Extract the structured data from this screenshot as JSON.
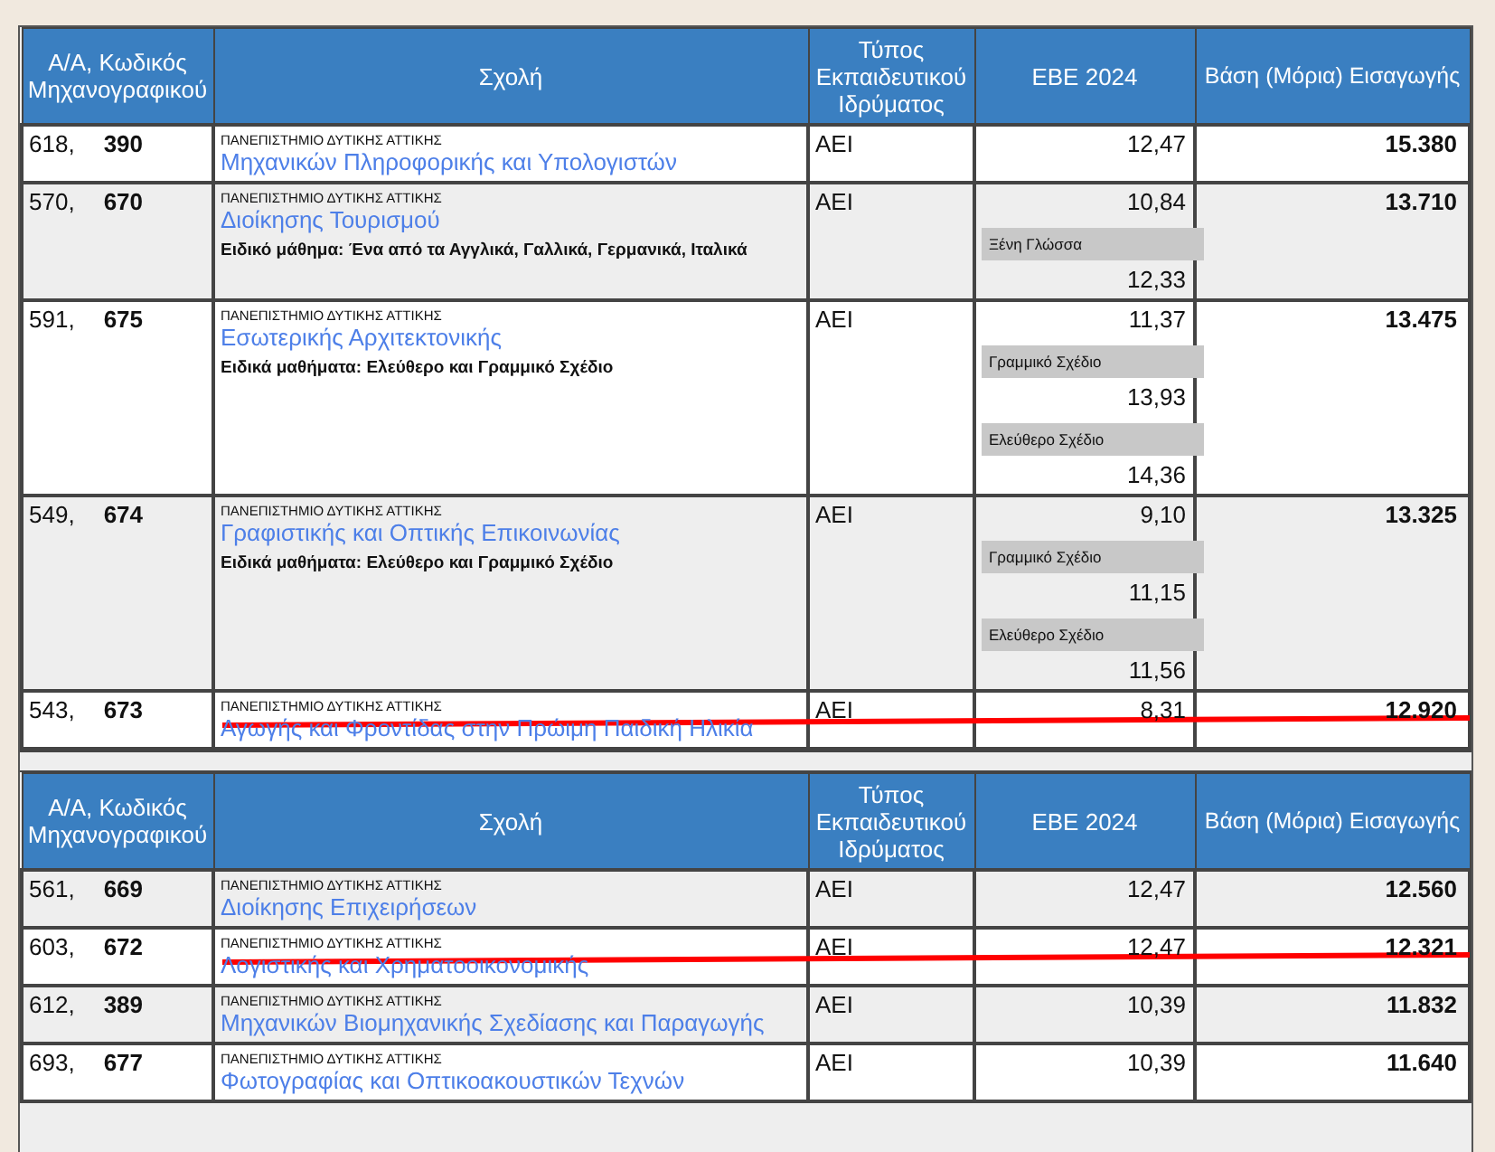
{
  "groups": [
    {
      "columns": [
        "Α/Α, Κωδικός Μηχανογραφικού",
        "Σχολή",
        "Τύπος Εκπαιδευτικού Ιδρύματος",
        "ΕΒΕ 2024",
        "Βάση (Μόρια) Εισαγωγής"
      ],
      "rows": [
        {
          "aa": "618,",
          "code": "390",
          "university": "ΠΑΝΕΠΙΣΤΗΜΙΟ ΔΥΤΙΚΗΣ ΑΤΤΙΚΗΣ",
          "school": "Μηχανικών Πληροφορικής και Υπολογιστών",
          "type": "ΑΕΙ",
          "ebe": "12,47",
          "base": "15.380",
          "struck": false
        },
        {
          "aa": "570,",
          "code": "670",
          "university": "ΠΑΝΕΠΙΣΤΗΜΙΟ ΔΥΤΙΚΗΣ ΑΤΤΙΚΗΣ",
          "school": "Διοίκησης Τουρισμού",
          "note": "Ειδικό μάθημα: Ένα από τα Αγγλικά, Γαλλικά, Γερμανικά, Ιταλικά",
          "type": "ΑΕΙ",
          "ebe": "10,84",
          "extra": [
            {
              "label": "Ξένη Γλώσσα",
              "value": "12,33"
            }
          ],
          "base": "13.710",
          "struck": false
        },
        {
          "aa": "591,",
          "code": "675",
          "university": "ΠΑΝΕΠΙΣΤΗΜΙΟ ΔΥΤΙΚΗΣ ΑΤΤΙΚΗΣ",
          "school": "Εσωτερικής Αρχιτεκτονικής",
          "note": "Ειδικά μαθήματα: Ελεύθερο και Γραμμικό Σχέδιο",
          "type": "ΑΕΙ",
          "ebe": "11,37",
          "extra": [
            {
              "label": "Γραμμικό Σχέδιο",
              "value": "13,93"
            },
            {
              "label": "Ελεύθερο Σχέδιο",
              "value": "14,36"
            }
          ],
          "base": "13.475",
          "struck": false
        },
        {
          "aa": "549,",
          "code": "674",
          "university": "ΠΑΝΕΠΙΣΤΗΜΙΟ ΔΥΤΙΚΗΣ ΑΤΤΙΚΗΣ",
          "school": "Γραφιστικής και Οπτικής Επικοινωνίας",
          "note": "Ειδικά μαθήματα: Ελεύθερο και Γραμμικό Σχέδιο",
          "type": "ΑΕΙ",
          "ebe": "9,10",
          "extra": [
            {
              "label": "Γραμμικό Σχέδιο",
              "value": "11,15"
            },
            {
              "label": "Ελεύθερο Σχέδιο",
              "value": "11,56"
            }
          ],
          "base": "13.325",
          "struck": false
        },
        {
          "aa": "543,",
          "code": "673",
          "university": "ΠΑΝΕΠΙΣΤΗΜΙΟ ΔΥΤΙΚΗΣ ΑΤΤΙΚΗΣ",
          "school": "Αγωγής και Φροντίδας στην Πρώιμη Παιδική Ηλικία",
          "type": "ΑΕΙ",
          "ebe": "8,31",
          "base": "12.920",
          "struck": true
        }
      ]
    },
    {
      "columns": [
        "Α/Α, Κωδικός Μηχανογραφικού",
        "Σχολή",
        "Τύπος Εκπαιδευτικού Ιδρύματος",
        "ΕΒΕ 2024",
        "Βάση (Μόρια) Εισαγωγής"
      ],
      "rows": [
        {
          "aa": "561,",
          "code": "669",
          "university": "ΠΑΝΕΠΙΣΤΗΜΙΟ ΔΥΤΙΚΗΣ ΑΤΤΙΚΗΣ",
          "school": "Διοίκησης Επιχειρήσεων",
          "type": "ΑΕΙ",
          "ebe": "12,47",
          "base": "12.560",
          "struck": false
        },
        {
          "aa": "603,",
          "code": "672",
          "university": "ΠΑΝΕΠΙΣΤΗΜΙΟ ΔΥΤΙΚΗΣ ΑΤΤΙΚΗΣ",
          "school": "Λογιστικής και Χρηματοοικονομικής",
          "type": "ΑΕΙ",
          "ebe": "12,47",
          "base": "12.321",
          "struck": true
        },
        {
          "aa": "612,",
          "code": "389",
          "university": "ΠΑΝΕΠΙΣΤΗΜΙΟ ΔΥΤΙΚΗΣ ΑΤΤΙΚΗΣ",
          "school": "Μηχανικών Βιομηχανικής Σχεδίασης και Παραγωγής",
          "type": "ΑΕΙ",
          "ebe": "10,39",
          "base": "11.832",
          "struck": false
        },
        {
          "aa": "693,",
          "code": "677",
          "university": "ΠΑΝΕΠΙΣΤΗΜΙΟ ΔΥΤΙΚΗΣ ΑΤΤΙΚΗΣ",
          "school": "Φωτογραφίας και Οπτικοακουστικών Τεχνών",
          "type": "ΑΕΙ",
          "ebe": "10,39",
          "base": "11.640",
          "struck": false
        }
      ]
    }
  ]
}
